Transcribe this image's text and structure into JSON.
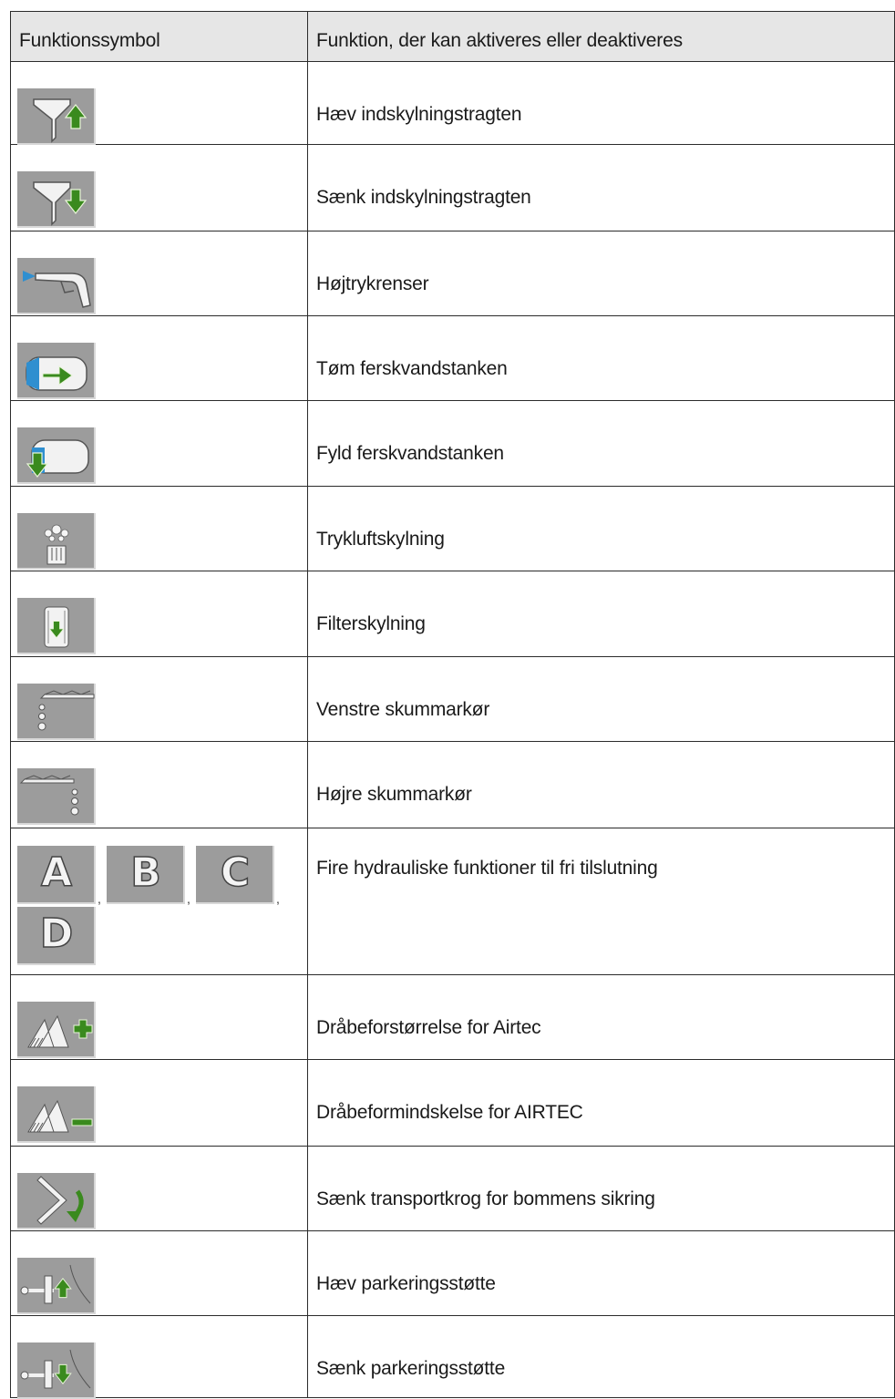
{
  "table": {
    "headers": {
      "symbol": "Funktionssymbol",
      "function": "Funktion, der kan aktiveres eller deaktiveres"
    },
    "rows": [
      {
        "icon": "funnel-raise-icon",
        "label": "Hæv indskylningstragten"
      },
      {
        "icon": "funnel-lower-icon",
        "label": "Sænk indskylningstragten"
      },
      {
        "icon": "high-pressure-cleaner-icon",
        "label": "Højtrykrenser"
      },
      {
        "icon": "freshwater-tank-empty-icon",
        "label": "Tøm ferskvandstanken"
      },
      {
        "icon": "freshwater-tank-fill-icon",
        "label": "Fyld ferskvandstanken"
      },
      {
        "icon": "compressed-air-rinse-icon",
        "label": "Trykluftskylning"
      },
      {
        "icon": "filter-rinse-icon",
        "label": "Filterskylning"
      },
      {
        "icon": "foam-marker-left-icon",
        "label": "Venstre skummarkør"
      },
      {
        "icon": "foam-marker-right-icon",
        "label": "Højre skummarkør"
      },
      {
        "icon": "hydraulic-abcd-icons",
        "label": "Fire hydrauliske funktioner til fri tilslutning",
        "letters": [
          "A",
          "B",
          "C",
          "D"
        ],
        "separator": ","
      },
      {
        "icon": "droplet-increase-icon",
        "label": "Dråbeforstørrelse for Airtec"
      },
      {
        "icon": "droplet-decrease-icon",
        "label": "Dråbeformindskelse for AIRTEC"
      },
      {
        "icon": "transport-hook-lower-icon",
        "label": "Sænk transportkrog for bommens sikring"
      },
      {
        "icon": "parking-stand-raise-icon",
        "label": "Hæv parkeringsstøtte"
      },
      {
        "icon": "parking-stand-lower-icon",
        "label": "Sænk parkeringsstøtte"
      }
    ]
  },
  "colors": {
    "icon_bg": "#9c9c9c",
    "arrow_green": "#3a8a1e",
    "water_blue": "#2f8fd0",
    "border": "#2b2b2b",
    "header_bg": "#e6e6e6"
  }
}
